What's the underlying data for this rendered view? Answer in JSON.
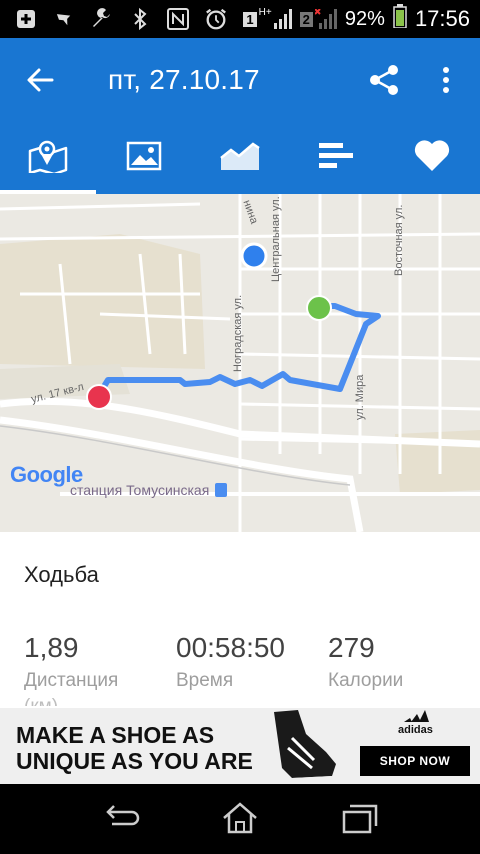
{
  "status_bar": {
    "battery": "92%",
    "time": "17:56",
    "sim1": "1",
    "sim2": "2",
    "network": "H+"
  },
  "header": {
    "title": "пт, 27.10.17"
  },
  "tabs": [
    {
      "name": "map",
      "icon": "map-icon",
      "active": true
    },
    {
      "name": "photos",
      "icon": "image-icon",
      "active": false
    },
    {
      "name": "chart",
      "icon": "area-chart-icon",
      "active": false
    },
    {
      "name": "splits",
      "icon": "bars-icon",
      "active": false
    },
    {
      "name": "heart",
      "icon": "heart-icon",
      "active": false
    }
  ],
  "map": {
    "streets": {
      "nina": "нина",
      "centralnaya": "Центральная ул.",
      "vostochnaya": "Восточная ул.",
      "nogradskaya": "Ноградская ул.",
      "mira": "ул. Мира",
      "kvartal": "ул. 17 кв-л"
    },
    "station": "станция Томусинская",
    "google_logo": "Google"
  },
  "activity": {
    "type": "Ходьба",
    "stats": [
      {
        "value": "1,89",
        "label": "Дистанция",
        "unit": "(км)"
      },
      {
        "value": "00:58:50",
        "label": "Время",
        "unit": ""
      },
      {
        "value": "279",
        "label": "Калории",
        "unit": ""
      }
    ]
  },
  "ad": {
    "line1": "MAKE A SHOE AS",
    "line2": "UNIQUE AS YOU ARE",
    "brand": "adidas",
    "cta": "SHOP NOW"
  },
  "colors": {
    "primary": "#1976d2",
    "route": "#4a8df0",
    "start_marker": "#6cc24a",
    "end_marker": "#e8344e",
    "location_dot": "#2f80ed"
  }
}
